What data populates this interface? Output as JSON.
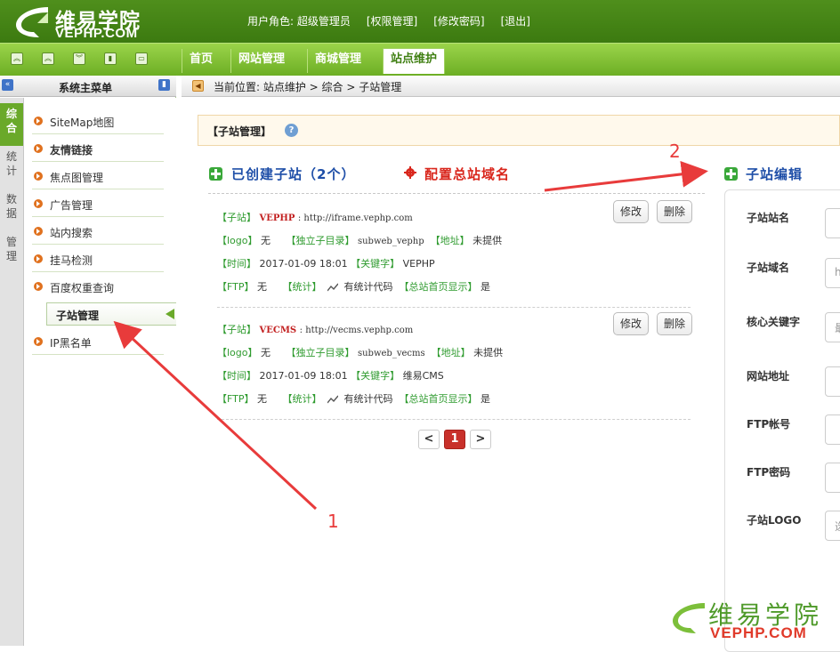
{
  "header": {
    "logo_cn": "维易学院",
    "logo_en": "VEPHP.COM",
    "user_role": "用户角色: 超级管理员",
    "links": [
      "[权限管理]",
      "[修改密码]",
      "[退出]"
    ]
  },
  "nav": {
    "tabs": [
      "首页",
      "网站管理",
      "商城管理",
      "站点维护"
    ],
    "active_tab": "站点维护"
  },
  "sidebar": {
    "title": "系统主菜单",
    "vtabs": [
      "综合",
      "统计",
      "数据",
      "管理"
    ],
    "items": [
      "SiteMap地图",
      "友情链接",
      "焦点图管理",
      "广告管理",
      "站内搜索",
      "挂马检测",
      "百度权重查询"
    ],
    "active_sub": "子站管理",
    "last_item": "IP黑名单"
  },
  "breadcrumb": "当前位置:  站点维护 > 综合 > 子站管理",
  "panel": {
    "title": "【子站管理】",
    "list_heading": "已创建子站（2个）",
    "config_link": "配置总站域名",
    "edit_heading": "子站编辑"
  },
  "labels": {
    "site": "【子站】",
    "logo": "【logo】",
    "subdir": "【独立子目录】",
    "addr": "【地址】",
    "time": "【时间】",
    "keyword": "【关键字】",
    "ftp": "【FTP】",
    "stat": "【统计】",
    "home_show": "【总站首页显示】",
    "edit_btn": "修改",
    "delete_btn": "删除"
  },
  "records": [
    {
      "name": "VEPHP",
      "url": ": http://iframe.vephp.com",
      "logo": "无",
      "subdir": "subweb_vephp",
      "addr": "未提供",
      "time": "2017-01-09 18:01",
      "keyword": "VEPHP",
      "ftp": "无",
      "stat": "有统计代码",
      "home_show": "是"
    },
    {
      "name": "VECMS",
      "url": ": http://vecms.vephp.com",
      "logo": "无",
      "subdir": "subweb_vecms",
      "addr": "未提供",
      "time": "2017-01-09 18:01",
      "keyword": "维易CMS",
      "ftp": "无",
      "stat": "有统计代码",
      "home_show": "是"
    }
  ],
  "pager": {
    "prev": "<",
    "current": "1",
    "next": ">"
  },
  "edit_form": {
    "fields": [
      "子站站名",
      "子站域名",
      "核心关键字",
      "网站地址",
      "FTP帐号",
      "FTP密码",
      "子站LOGO"
    ],
    "input_hints": [
      "",
      "h",
      "最",
      "",
      "",
      "",
      "选"
    ]
  },
  "annotations": [
    "1",
    "2"
  ],
  "watermark": {
    "cn": "维易学院",
    "en": "VEPHP.COM"
  },
  "colors": {
    "header_green": "#3c7a10",
    "nav_green": "#6cae24",
    "accent_blue": "#1f4fa8",
    "accent_red": "#d9261c",
    "arrow_red": "#e83b3b"
  }
}
